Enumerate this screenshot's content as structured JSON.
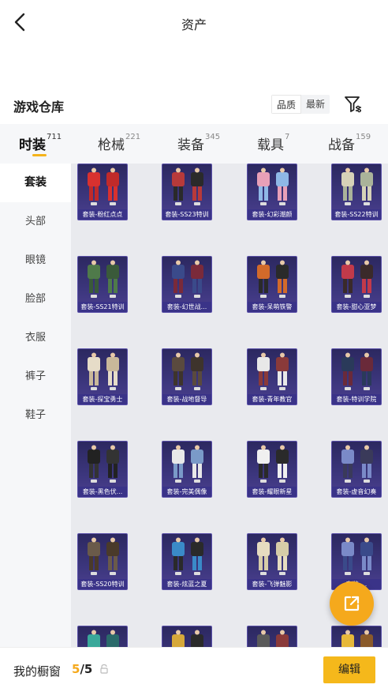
{
  "header": {
    "title": "资产"
  },
  "section": {
    "title": "游戏仓库",
    "sort_options": [
      "品质",
      "最新"
    ],
    "filter_icon": "filter-settings-icon"
  },
  "tabs": [
    {
      "label": "时装",
      "count": "711",
      "active": true
    },
    {
      "label": "枪械",
      "count": "221"
    },
    {
      "label": "装备",
      "count": "345"
    },
    {
      "label": "载具",
      "count": "7"
    },
    {
      "label": "战备",
      "count": "159"
    }
  ],
  "sidebar": {
    "items": [
      "套装",
      "头部",
      "眼镜",
      "脸部",
      "衣服",
      "裤子",
      "鞋子"
    ]
  },
  "items": [
    {
      "label": "套装-粉红点点",
      "colors": [
        "#d8312f",
        "#c02a2a"
      ]
    },
    {
      "label": "套装-SS23特训",
      "colors": [
        "#b73a3a",
        "#2a2a2a"
      ]
    },
    {
      "label": "套装-幻彩潮颜",
      "colors": [
        "#e8a0b8",
        "#8fb8e6"
      ]
    },
    {
      "label": "套装-SS22特训",
      "colors": [
        "#d6d2b8",
        "#aab39a"
      ]
    },
    {
      "label": "套装-SS21特训",
      "colors": [
        "#4f7a4a",
        "#3a5a3a"
      ]
    },
    {
      "label": "套装-幻世战...",
      "colors": [
        "#3a4a8a",
        "#7a2a3a"
      ]
    },
    {
      "label": "套装-呆萌铁警",
      "colors": [
        "#d26a2a",
        "#2a2a2a"
      ]
    },
    {
      "label": "套装-甜心亚梦",
      "colors": [
        "#c23a4a",
        "#3a2a2a"
      ]
    },
    {
      "label": "套装-探宝勇士",
      "colors": [
        "#e6dcc8",
        "#c9b89a"
      ]
    },
    {
      "label": "套装-战地督导",
      "colors": [
        "#5a4a3e",
        "#3e342c"
      ]
    },
    {
      "label": "套装-青年教官",
      "colors": [
        "#e8e8e8",
        "#8a3a3a"
      ]
    },
    {
      "label": "套装-特训学院",
      "colors": [
        "#2a3a5a",
        "#6a2a3a"
      ]
    },
    {
      "label": "套装-黑色伏...",
      "colors": [
        "#222222",
        "#333333"
      ]
    },
    {
      "label": "套装-完美偶像",
      "colors": [
        "#e8e8e8",
        "#7a9ac8"
      ]
    },
    {
      "label": "套装-耀眼新星",
      "colors": [
        "#f0f0f0",
        "#2a2a2a"
      ]
    },
    {
      "label": "套装-虚音幻奏",
      "colors": [
        "#7a8ac8",
        "#3a3a5a"
      ]
    },
    {
      "label": "套装-SS20特训",
      "colors": [
        "#6a5a4a",
        "#4a3a2a"
      ]
    },
    {
      "label": "套装-炫蓝之夏",
      "colors": [
        "#3a8ac8",
        "#2a2a2a"
      ]
    },
    {
      "label": "套装-飞弹魅影",
      "colors": [
        "#e6dcc0",
        "#d6cca8"
      ]
    },
    {
      "label": "套装-...",
      "colors": [
        "#7a8ac8",
        "#3a4a8a"
      ]
    },
    {
      "label": "",
      "colors": [
        "#3aa89a",
        "#2a6a6a"
      ]
    },
    {
      "label": "",
      "colors": [
        "#d6a83a",
        "#2a2a2a"
      ]
    },
    {
      "label": "",
      "colors": [
        "#5a5a5a",
        "#8a3a3a"
      ]
    },
    {
      "label": "",
      "colors": [
        "#e6b83a",
        "#8a5a2a"
      ]
    }
  ],
  "fab": {
    "icon": "share-external-icon"
  },
  "bottom": {
    "label": "我的橱窗",
    "current": "5",
    "total": "/5",
    "edit_label": "编辑"
  },
  "colors": {
    "accent": "#f5a91c",
    "card": "#3c367d"
  }
}
